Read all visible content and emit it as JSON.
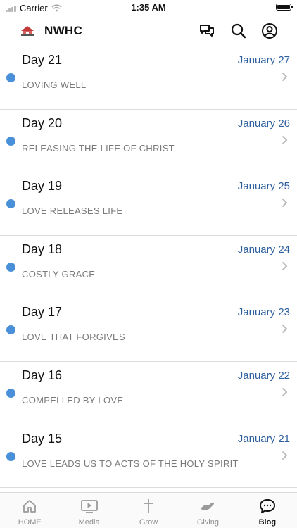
{
  "status": {
    "carrier": "Carrier",
    "time": "1:35 AM"
  },
  "header": {
    "title": "NWHC"
  },
  "days": [
    {
      "title": "Day 21",
      "date": "January 27",
      "subtitle": "LOVING WELL"
    },
    {
      "title": "Day 20",
      "date": "January 26",
      "subtitle": "RELEASING THE LIFE OF CHRIST"
    },
    {
      "title": "Day 19",
      "date": "January 25",
      "subtitle": "LOVE RELEASES LIFE"
    },
    {
      "title": "Day 18",
      "date": "January 24",
      "subtitle": "COSTLY GRACE"
    },
    {
      "title": "Day 17",
      "date": "January 23",
      "subtitle": "LOVE THAT FORGIVES"
    },
    {
      "title": "Day 16",
      "date": "January 22",
      "subtitle": "COMPELLED BY LOVE"
    },
    {
      "title": "Day 15",
      "date": "January 21",
      "subtitle": "LOVE LEADS US TO ACTS OF THE HOLY SPIRIT"
    }
  ],
  "tabs": [
    {
      "label": "HOME",
      "icon": "home-icon"
    },
    {
      "label": "Media",
      "icon": "media-icon"
    },
    {
      "label": "Grow",
      "icon": "cross-icon"
    },
    {
      "label": "Giving",
      "icon": "giving-hand-icon"
    },
    {
      "label": "Blog",
      "icon": "chat-bubble-icon",
      "active": true
    }
  ],
  "colors": {
    "unread_dot": "#4a90d9",
    "date_text": "#2d5f9e"
  }
}
